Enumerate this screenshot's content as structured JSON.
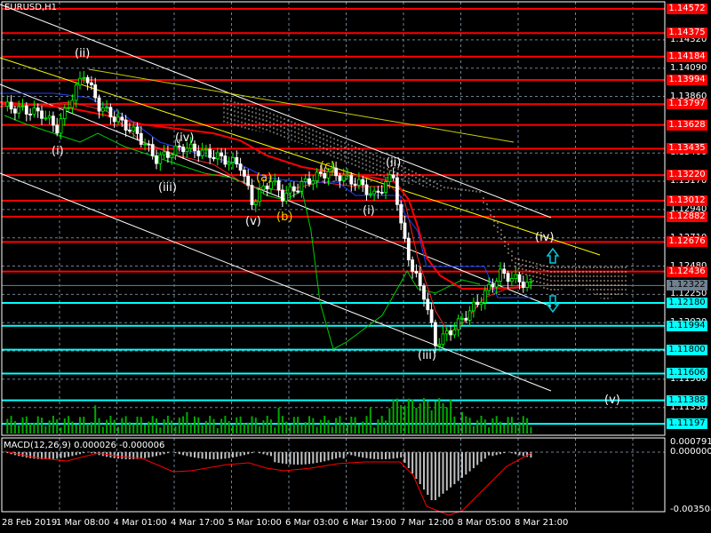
{
  "window": {
    "title": "EURUSD,H1"
  },
  "indicator": {
    "label": "MACD(12,26,9) 0.000026 -0.000006",
    "axis_max": "0.000791",
    "axis_zero": "0.000000",
    "axis_min": "-0.003508"
  },
  "price_levels": [
    {
      "value": "1.14572",
      "color": "#ff0000"
    },
    {
      "value": "1.14375",
      "color": "#ff0000"
    },
    {
      "value": "1.14184",
      "color": "#ff0000"
    },
    {
      "value": "1.13994",
      "color": "#ff0000"
    },
    {
      "value": "1.13797",
      "color": "#ff0000"
    },
    {
      "value": "1.13628",
      "color": "#ff0000"
    },
    {
      "value": "1.13435",
      "color": "#ff0000"
    },
    {
      "value": "1.13220",
      "color": "#ff0000"
    },
    {
      "value": "1.13012",
      "color": "#ff0000"
    },
    {
      "value": "1.12882",
      "color": "#ff0000"
    },
    {
      "value": "1.12676",
      "color": "#ff0000"
    },
    {
      "value": "1.12436",
      "color": "#ff0000"
    },
    {
      "value": "1.12180",
      "color": "#00ffff"
    },
    {
      "value": "1.11994",
      "color": "#00ffff"
    },
    {
      "value": "1.11800",
      "color": "#00ffff"
    },
    {
      "value": "1.11606",
      "color": "#00ffff"
    },
    {
      "value": "1.11388",
      "color": "#00ffff"
    },
    {
      "value": "1.11197",
      "color": "#00ffff"
    }
  ],
  "current_price": "1.12322",
  "price_ticks": [
    "1.14320",
    "1.14090",
    "1.13860",
    "1.13630",
    "1.13400",
    "1.13170",
    "1.12940",
    "1.12710",
    "1.12480",
    "1.12250",
    "1.12020",
    "1.11790",
    "1.11560",
    "1.11330"
  ],
  "time_labels": [
    "28 Feb 2019",
    "1 Mar 08:00",
    "4 Mar 01:00",
    "4 Mar 17:00",
    "5 Mar 10:00",
    "6 Mar 03:00",
    "6 Mar 19:00",
    "7 Mar 12:00",
    "8 Mar 05:00",
    "8 Mar 21:00"
  ],
  "waves": [
    "(ii)",
    "(i)",
    "(iv)",
    "(iii)",
    "(v)",
    "(a)",
    "(b)",
    "(c)",
    "(ii)",
    "(i)",
    "(iii)",
    "(iv)",
    "(v)"
  ],
  "chart_data": {
    "type": "candlestick",
    "symbol": "EURUSD",
    "timeframe": "H1",
    "keypoints_bar_price": [
      [
        0,
        1.1378
      ],
      [
        10,
        1.1372
      ],
      [
        14,
        1.136
      ],
      [
        21,
        1.1405
      ],
      [
        25,
        1.1378
      ],
      [
        35,
        1.1355
      ],
      [
        40,
        1.1335
      ],
      [
        47,
        1.1345
      ],
      [
        55,
        1.1338
      ],
      [
        62,
        1.133
      ],
      [
        65,
        1.13
      ],
      [
        70,
        1.1318
      ],
      [
        73,
        1.1305
      ],
      [
        80,
        1.1318
      ],
      [
        85,
        1.1325
      ],
      [
        93,
        1.1315
      ],
      [
        97,
        1.1305
      ],
      [
        102,
        1.1322
      ],
      [
        104,
        1.128
      ],
      [
        107,
        1.1245
      ],
      [
        110,
        1.1225
      ],
      [
        113,
        1.1185
      ],
      [
        118,
        1.1198
      ],
      [
        124,
        1.1218
      ],
      [
        130,
        1.1242
      ],
      [
        138,
        1.1232
      ]
    ],
    "ylim": [
      1.1106,
      1.1462
    ]
  },
  "colors": {
    "resistance": "#ff0000",
    "support": "#00ffff",
    "bull": "#00ff00",
    "bear": "#ffffff",
    "current": "#708090"
  }
}
